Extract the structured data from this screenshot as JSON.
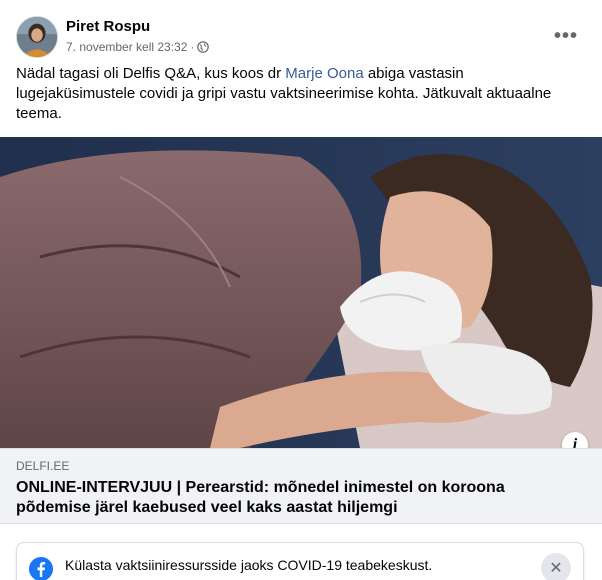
{
  "post": {
    "author": "Piret Rospu",
    "timestamp": "7. november kell 23:32",
    "separator": "·",
    "privacy_icon": "globe-icon",
    "more_label": "•••",
    "text_before": "Nädal tagasi oli Delfis Q&A, kus koos dr ",
    "mention": "Marje Oona",
    "text_after": " abiga vastasin lugejaküsimustele covidi ja gripi vastu vaktsineerimise kohta. Jätkuvalt aktuaalne teema.",
    "mention_color": "#385898"
  },
  "photo": {
    "info_label": "i"
  },
  "link_preview": {
    "domain": "DELFI.EE",
    "title": "ONLINE-INTERVJUU | Perearstid: mõnedel inimestel on koroona põdemise järel kaebused veel kaks aastat hiljemgi"
  },
  "covid_banner": {
    "icon": "facebook-icon",
    "text": "Külasta vaktsiiniressursside jaoks COVID-19 teabekeskust.",
    "close_label": "✕",
    "brand_color": "#1877f2"
  }
}
